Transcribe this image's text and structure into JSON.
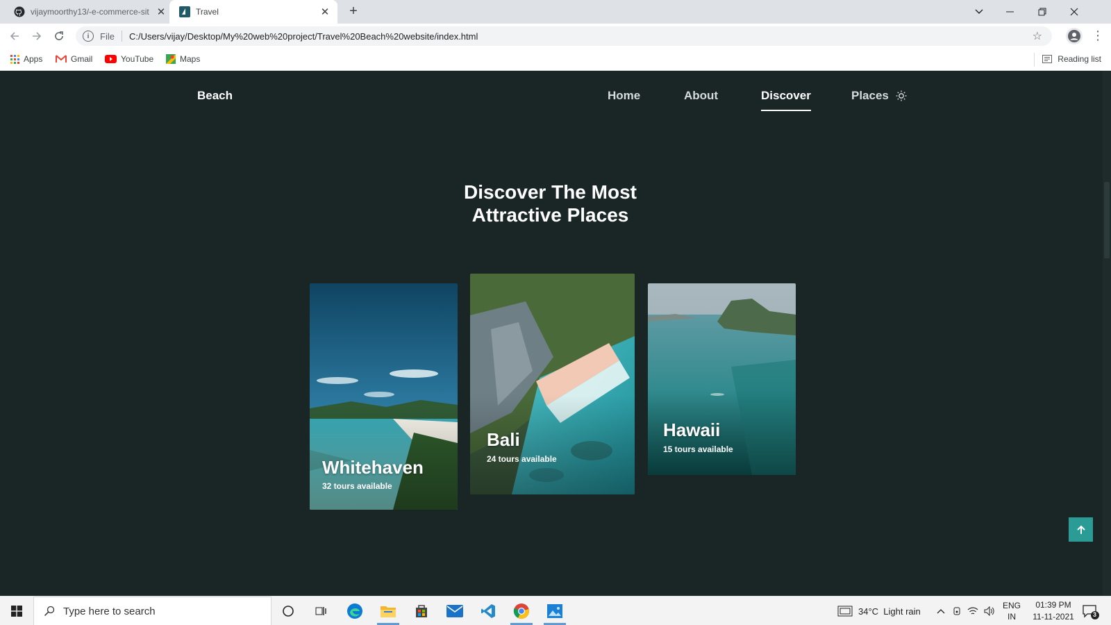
{
  "browser": {
    "tabs": [
      {
        "title": "vijaymoorthy13/-e-commerce-sit",
        "favicon": "github-icon"
      },
      {
        "title": "Travel",
        "favicon": "travel-favicon"
      }
    ],
    "address": {
      "scheme": "File",
      "url": "C:/Users/vijay/Desktop/My%20web%20project/Travel%20Beach%20website/index.html"
    },
    "bookmarks": [
      "Apps",
      "Gmail",
      "YouTube",
      "Maps"
    ],
    "reading_list": "Reading list"
  },
  "site": {
    "logo": "Beach",
    "nav": [
      "Home",
      "About",
      "Discover",
      "Places"
    ],
    "active_nav": "Discover",
    "heading_line1": "Discover The Most",
    "heading_line2": "Attractive Places",
    "cards": [
      {
        "name": "Whitehaven",
        "tours": "32 tours available"
      },
      {
        "name": "Bali",
        "tours": "24 tours available"
      },
      {
        "name": "Hawaii",
        "tours": "15 tours available"
      }
    ]
  },
  "taskbar": {
    "search_placeholder": "Type here to search",
    "weather": "34°C  Light rain",
    "lang_top": "ENG",
    "lang_bottom": "IN",
    "time": "01:39 PM",
    "date": "11-11-2021",
    "notifications": "3"
  },
  "colors": {
    "page_bg": "#1a2625",
    "accent": "#2a9c95"
  }
}
